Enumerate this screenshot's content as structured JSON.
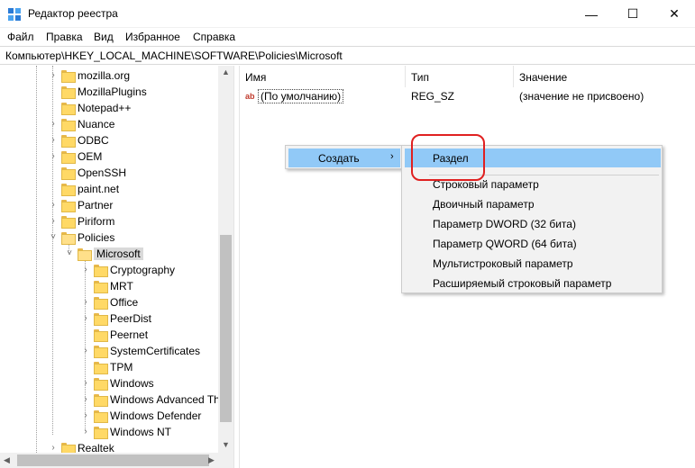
{
  "window": {
    "title": "Редактор реестра",
    "icon": "registry-editor-icon",
    "controls": {
      "minimize": "—",
      "maximize": "☐",
      "close": "✕"
    }
  },
  "menu": {
    "items": [
      "Файл",
      "Правка",
      "Вид",
      "Избранное",
      "Справка"
    ]
  },
  "address": {
    "path": "Компьютер\\HKEY_LOCAL_MACHINE\\SOFTWARE\\Policies\\Microsoft"
  },
  "tree": {
    "items": [
      {
        "label": "mozilla.org",
        "expander": "›"
      },
      {
        "label": "MozillaPlugins",
        "expander": ""
      },
      {
        "label": "Notepad++",
        "expander": ""
      },
      {
        "label": "Nuance",
        "expander": "›"
      },
      {
        "label": "ODBC",
        "expander": "›"
      },
      {
        "label": "OEM",
        "expander": "›"
      },
      {
        "label": "OpenSSH",
        "expander": ""
      },
      {
        "label": "paint.net",
        "expander": ""
      },
      {
        "label": "Partner",
        "expander": "›"
      },
      {
        "label": "Piriform",
        "expander": "›"
      },
      {
        "label": "Policies",
        "expander": "˅"
      },
      {
        "label": "Microsoft",
        "expander": "˅"
      },
      {
        "label": "Cryptography",
        "expander": "›"
      },
      {
        "label": "MRT",
        "expander": ""
      },
      {
        "label": "Office",
        "expander": "›"
      },
      {
        "label": "PeerDist",
        "expander": "›"
      },
      {
        "label": "Peernet",
        "expander": ""
      },
      {
        "label": "SystemCertificates",
        "expander": "›"
      },
      {
        "label": "TPM",
        "expander": ""
      },
      {
        "label": "Windows",
        "expander": "›"
      },
      {
        "label": "Windows Advanced Th",
        "expander": "›"
      },
      {
        "label": "Windows Defender",
        "expander": "›"
      },
      {
        "label": "Windows NT",
        "expander": "›"
      },
      {
        "label": "Realtek",
        "expander": "›"
      }
    ],
    "selected": "Microsoft"
  },
  "columns": {
    "name": "Имя",
    "type": "Тип",
    "data": "Значение"
  },
  "values": [
    {
      "name": "(По умолчанию)",
      "type": "REG_SZ",
      "data": "(значение не присвоено)",
      "icon": "string-value-icon"
    }
  ],
  "context_menu": {
    "create_label": "Создать",
    "arrow": "›"
  },
  "submenu": {
    "items": [
      "Раздел",
      "Строковый параметр",
      "Двоичный параметр",
      "Параметр DWORD (32 бита)",
      "Параметр QWORD (64 бита)",
      "Мультистроковый параметр",
      "Расширяемый строковый параметр"
    ],
    "highlighted": "Раздел"
  },
  "colors": {
    "highlight": "#91c9f7",
    "annotation": "#e02020",
    "folder": "#ffd966"
  }
}
